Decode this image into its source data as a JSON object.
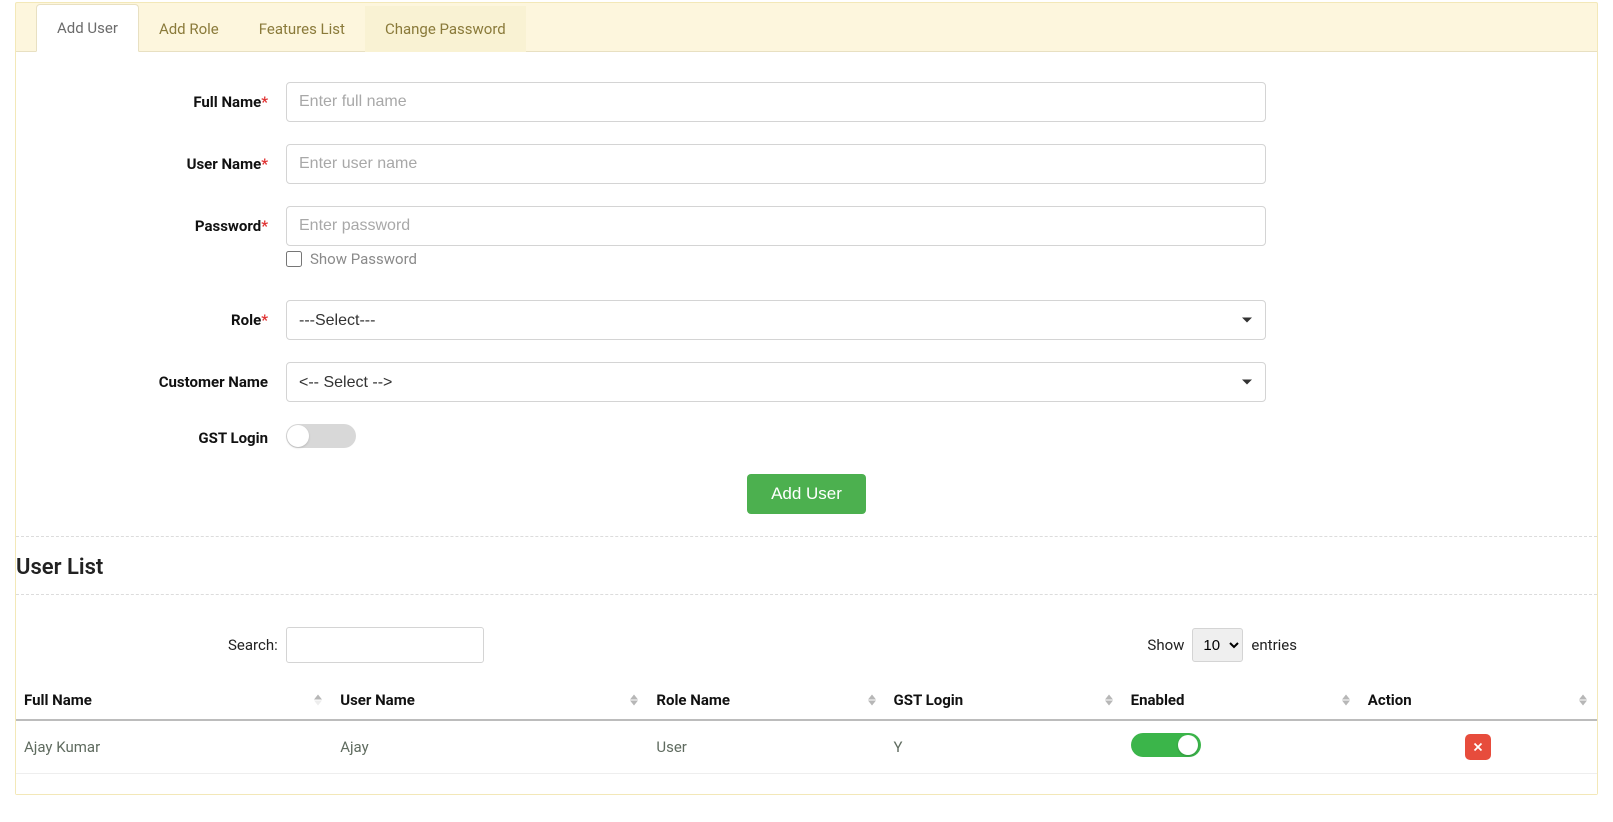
{
  "tabs": [
    {
      "label": "Add User"
    },
    {
      "label": "Add Role"
    },
    {
      "label": "Features List"
    },
    {
      "label": "Change Password"
    }
  ],
  "form": {
    "fullName": {
      "label": "Full Name",
      "placeholder": "Enter full name"
    },
    "userName": {
      "label": "User Name",
      "placeholder": "Enter user name"
    },
    "password": {
      "label": "Password",
      "placeholder": "Enter password"
    },
    "showPassword": {
      "label": "Show Password"
    },
    "role": {
      "label": "Role",
      "selected": "---Select---"
    },
    "customerName": {
      "label": "Customer Name",
      "selected": "<-- Select -->"
    },
    "gstLogin": {
      "label": "GST Login"
    },
    "submit": "Add User"
  },
  "listSection": {
    "title": "User List",
    "searchLabel": "Search:",
    "showLabel": "Show",
    "entriesLabel": "entries",
    "pageSize": "10"
  },
  "table": {
    "headers": {
      "fullName": "Full Name",
      "userName": "User Name",
      "roleName": "Role Name",
      "gstLogin": "GST Login",
      "enabled": "Enabled",
      "action": "Action"
    },
    "rows": [
      {
        "fullName": "Ajay Kumar",
        "userName": "Ajay",
        "roleName": "User",
        "gstLogin": "Y",
        "enabled": true
      }
    ]
  }
}
